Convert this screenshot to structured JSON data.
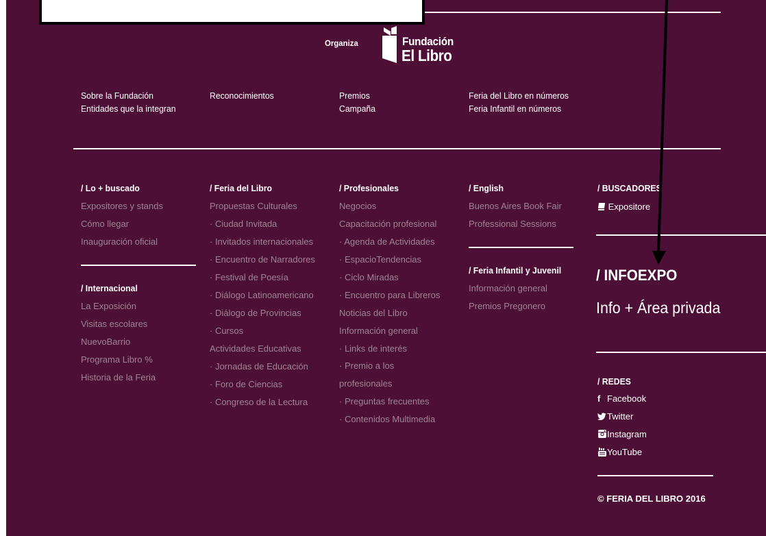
{
  "logo": {
    "organiza": "Organiza",
    "line1": "Fundación",
    "line2": "El Libro"
  },
  "top_links": {
    "col1": [
      "Sobre la Fundación",
      "Entidades que la integran"
    ],
    "col2": [
      "Reconocimientos"
    ],
    "col3": [
      "Premios",
      "Campaña"
    ],
    "col4": [
      "Feria del Libro en números",
      "Feria Infantil en números"
    ]
  },
  "columns": {
    "lo_buscado": {
      "heading": "/ Lo + buscado",
      "items": [
        "Expositores y stands",
        "Cómo llegar",
        "Inauguración oficial"
      ]
    },
    "internacional": {
      "heading": "/ Internacional",
      "items": [
        "La Exposición",
        "Visitas escolares",
        "NuevoBarrio",
        "Programa Libro %",
        "Historia de la Feria"
      ]
    },
    "feria": {
      "heading": "/ Feria del Libro",
      "items": [
        "Propuestas Culturales",
        "· Ciudad Invitada",
        "· Invitados internacionales",
        "· Encuentro de Narradores",
        "· Festival de Poesía",
        "· Diálogo Latinoamericano",
        "· Diálogo de Provincias",
        "· Cursos",
        "Actividades Educativas",
        "· Jornadas de Educación",
        "· Foro de Ciencias",
        "· Congreso de la Lectura"
      ]
    },
    "profesionales": {
      "heading": "/ Profesionales",
      "items": [
        "Negocios",
        "Capacitación profesional",
        "· Agenda de Actividades",
        "· EspacioTendencias",
        "· Ciclo Miradas",
        "· Encuentro para Libreros",
        "Noticias del Libro",
        "Información general",
        "· Links de interés",
        "· Premio a los profesionales",
        "· Preguntas frecuentes",
        "· Contenidos Multimedia"
      ]
    },
    "english": {
      "heading": "/ English",
      "items": [
        "Buenos Aires Book Fair",
        "Professional Sessions"
      ]
    },
    "infantil": {
      "heading": "/ Feria Infantil y Juvenil",
      "items": [
        "Información general",
        "Premios Pregonero"
      ]
    }
  },
  "buscadores": {
    "heading": "/ BUSCADORES",
    "expositores": "Expositore"
  },
  "infoexpo": {
    "title": "/ INFOEXPO",
    "link": "Info + Área privada"
  },
  "redes": {
    "heading": "/ REDES",
    "facebook_icon": "f",
    "facebook": "Facebook",
    "twitter": "Twitter",
    "instagram": "Instagram",
    "youtube": "YouTube"
  },
  "copyright": "© FERIA DEL LIBRO 2016",
  "colors": {
    "background": "#4e0f37",
    "link_muted": "#9e8295",
    "text": "#ffffff"
  },
  "icons": [
    "book-icon",
    "facebook-icon",
    "twitter-icon",
    "instagram-icon",
    "youtube-icon",
    "arrow-down-icon"
  ]
}
